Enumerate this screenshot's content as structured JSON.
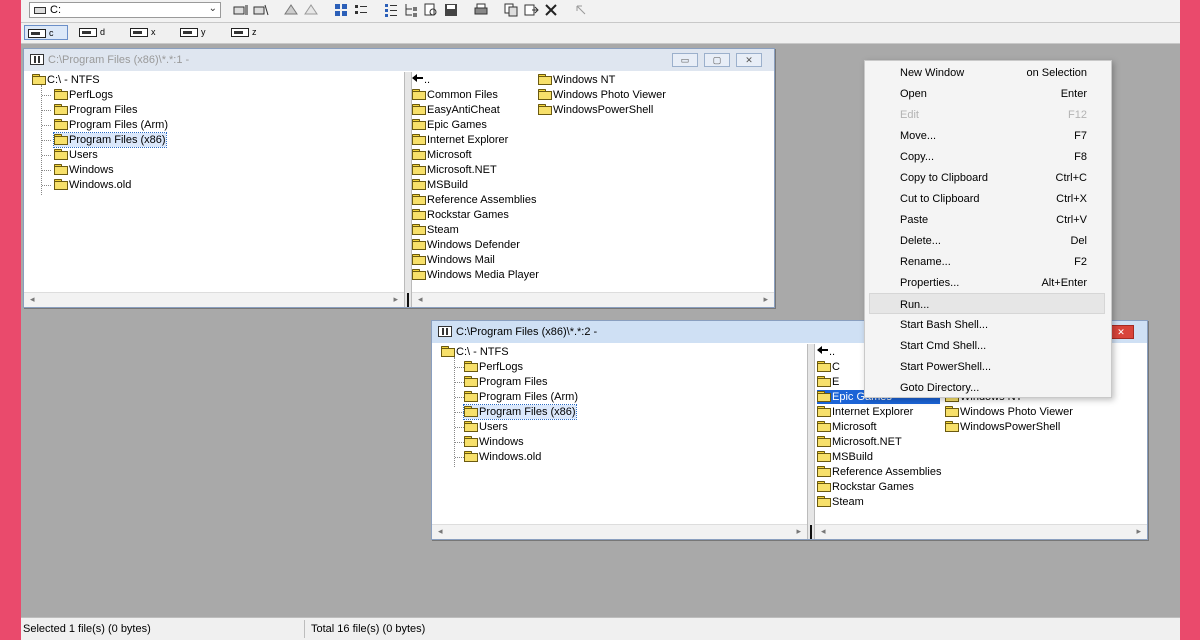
{
  "toolbar": {
    "drive_value": "C:"
  },
  "drive_bar": [
    {
      "label": "c",
      "active": true
    },
    {
      "label": "d",
      "active": false
    },
    {
      "label": "x",
      "active": false
    },
    {
      "label": "y",
      "active": false
    },
    {
      "label": "z",
      "active": false
    }
  ],
  "window1": {
    "title": "C:\\Program Files (x86)\\*.*:1 -",
    "tree": [
      "C:\\ - NTFS",
      "PerfLogs",
      "Program Files",
      "Program Files (Arm)",
      "Program Files (x86)",
      "Users",
      "Windows",
      "Windows.old"
    ],
    "files_col1": [
      "..",
      "Common Files",
      "EasyAntiCheat",
      "Epic Games",
      "Internet Explorer",
      "Microsoft",
      "Microsoft.NET",
      "MSBuild",
      "Reference Assemblies",
      "Rockstar Games",
      "Steam",
      "Windows Defender",
      "Windows Mail",
      "Windows Media Player"
    ],
    "files_col2": [
      "Windows NT",
      "Windows Photo Viewer",
      "WindowsPowerShell"
    ]
  },
  "window2": {
    "title": "C:\\Program Files (x86)\\*.*:2 -",
    "tree": [
      "C:\\ - NTFS",
      "PerfLogs",
      "Program Files",
      "Program Files (Arm)",
      "Program Files (x86)",
      "Users",
      "Windows",
      "Windows.old"
    ],
    "files_col1": [
      "..",
      "C",
      "E",
      "Epic Games",
      "Internet Explorer",
      "Microsoft",
      "Microsoft.NET",
      "MSBuild",
      "Reference Assemblies",
      "Rockstar Games",
      "Steam"
    ],
    "files_col2": [
      "Windows NT",
      "Windows Photo Viewer",
      "WindowsPowerShell"
    ]
  },
  "context_menu": [
    {
      "label": "New Window",
      "shortcut": "on Selection",
      "disabled": false
    },
    {
      "label": "Open",
      "shortcut": "Enter",
      "disabled": false
    },
    {
      "label": "Edit",
      "shortcut": "F12",
      "disabled": true
    },
    {
      "label": "Move...",
      "shortcut": "F7",
      "disabled": false
    },
    {
      "label": "Copy...",
      "shortcut": "F8",
      "disabled": false
    },
    {
      "label": "Copy to Clipboard",
      "shortcut": "Ctrl+C",
      "disabled": false
    },
    {
      "label": "Cut to Clipboard",
      "shortcut": "Ctrl+X",
      "disabled": false
    },
    {
      "label": "Paste",
      "shortcut": "Ctrl+V",
      "disabled": false
    },
    {
      "label": "Delete...",
      "shortcut": "Del",
      "disabled": false
    },
    {
      "label": "Rename...",
      "shortcut": "F2",
      "disabled": false
    },
    {
      "label": "Properties...",
      "shortcut": "Alt+Enter",
      "disabled": false
    },
    {
      "label": "Run...",
      "shortcut": "",
      "disabled": false
    },
    {
      "label": "Start Bash Shell...",
      "shortcut": "",
      "disabled": false
    },
    {
      "label": "Start Cmd Shell...",
      "shortcut": "",
      "disabled": false
    },
    {
      "label": "Start PowerShell...",
      "shortcut": "",
      "disabled": false
    },
    {
      "label": "Goto Directory...",
      "shortcut": "",
      "disabled": false
    }
  ],
  "status": {
    "selected": "Selected 1 file(s) (0 bytes)",
    "total": "Total 16 file(s) (0 bytes)"
  },
  "colors": {
    "frame": "#ea4a6c",
    "workspace": "#a9a9a9",
    "selection": "#1b63d6",
    "folder": "#f7e06a"
  }
}
